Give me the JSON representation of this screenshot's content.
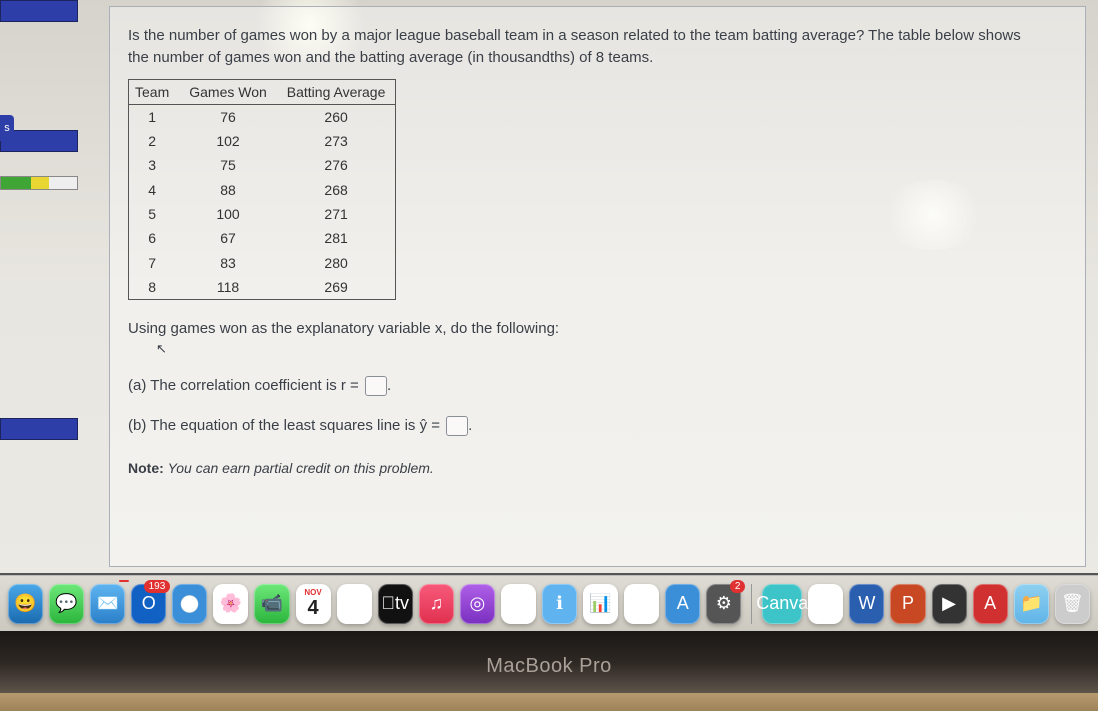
{
  "problem": {
    "prompt_line1": "Is the number of games won by a major league baseball team in a season related to the team batting average? The table below shows",
    "prompt_line2": "the number of games won and the batting average (in thousandths) of 8 teams.",
    "table": {
      "headers": [
        "Team",
        "Games Won",
        "Batting Average"
      ],
      "rows": [
        {
          "team": "1",
          "games_won": "76",
          "batting_avg": "260"
        },
        {
          "team": "2",
          "games_won": "102",
          "batting_avg": "273"
        },
        {
          "team": "3",
          "games_won": "75",
          "batting_avg": "276"
        },
        {
          "team": "4",
          "games_won": "88",
          "batting_avg": "268"
        },
        {
          "team": "5",
          "games_won": "100",
          "batting_avg": "271"
        },
        {
          "team": "6",
          "games_won": "67",
          "batting_avg": "281"
        },
        {
          "team": "7",
          "games_won": "83",
          "batting_avg": "280"
        },
        {
          "team": "8",
          "games_won": "118",
          "batting_avg": "269"
        }
      ]
    },
    "instruction": "Using games won as the explanatory variable x, do the following:",
    "part_a_text": "(a) The correlation coefficient is r =",
    "part_b_text": "(b) The equation of the least squares line is ŷ =",
    "note_label": "Note:",
    "note_text": "You can earn partial credit on this problem."
  },
  "sidebar": {
    "status_letter": "s"
  },
  "dock": {
    "calendar_month": "NOV",
    "calendar_day": "4",
    "outlook_badge": "193",
    "sys_badge": "2",
    "canva_label": "Canva"
  },
  "device": {
    "label": "MacBook Pro"
  },
  "chart_data": {
    "type": "table",
    "title": "Games Won vs Batting Average for 8 MLB teams",
    "columns": [
      "Team",
      "Games Won",
      "Batting Average"
    ],
    "rows": [
      [
        1,
        76,
        260
      ],
      [
        2,
        102,
        273
      ],
      [
        3,
        75,
        276
      ],
      [
        4,
        88,
        268
      ],
      [
        5,
        100,
        271
      ],
      [
        6,
        67,
        281
      ],
      [
        7,
        83,
        280
      ],
      [
        8,
        118,
        269
      ]
    ]
  }
}
